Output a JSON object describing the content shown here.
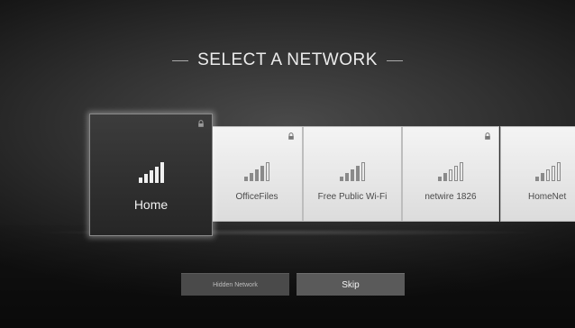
{
  "title": "SELECT A NETWORK",
  "networks": [
    {
      "name": "Home",
      "signal_level": 5,
      "locked": true,
      "selected": true
    },
    {
      "name": "OfficeFiles",
      "signal_level": 4,
      "locked": true,
      "selected": false
    },
    {
      "name": "Free Public Wi-Fi",
      "signal_level": 4,
      "locked": false,
      "selected": false
    },
    {
      "name": "netwire 1826",
      "signal_level": 2,
      "locked": true,
      "selected": false
    },
    {
      "name": "HomeNet",
      "signal_level": 2,
      "locked": false,
      "selected": false
    }
  ],
  "buttons": {
    "hidden_network": "Hidden Network",
    "skip": "Skip"
  },
  "icons": {
    "signal": "wifi-signal-icon",
    "lock": "lock-icon"
  },
  "colors": {
    "background": "#323232",
    "tile": "#e8e8e8",
    "tile_selected": "#2e2e2e",
    "bar_active": "#8a8a8a",
    "bar_active_selected": "#f0f0f0"
  }
}
